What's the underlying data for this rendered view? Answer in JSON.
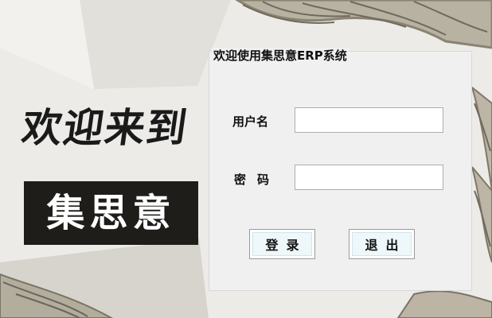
{
  "window": {
    "welcome_text": "欢迎来到",
    "brand_name": "集思意"
  },
  "login_panel": {
    "title": "欢迎使用集思意ERP系统",
    "username_label": "用户名",
    "password_label": "密码",
    "username_value": "",
    "password_value": "",
    "login_button_label": "登录",
    "exit_button_label": "退出"
  },
  "colors": {
    "background": "#ecebe7",
    "panel": "#f0f0f0",
    "brand_block": "#1e1d1a",
    "button_face": "#eef7f9"
  }
}
